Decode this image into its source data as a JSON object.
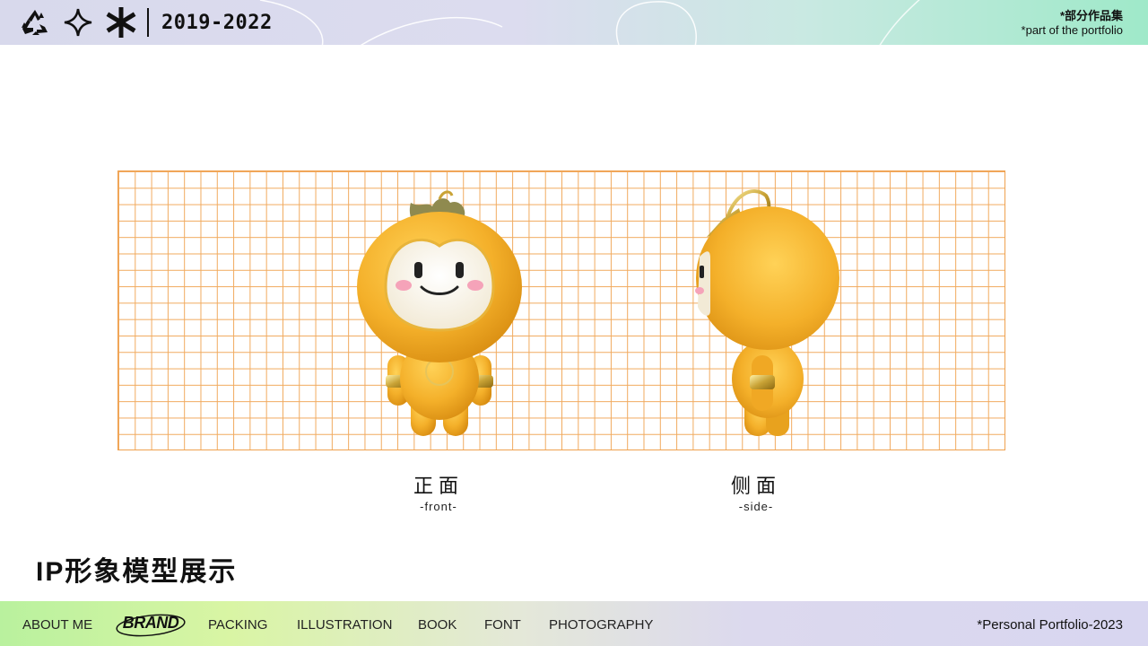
{
  "header": {
    "icons": [
      "recycle-icon",
      "four-point-star-icon",
      "asterisk-icon"
    ],
    "years": "2019-2022",
    "right_cn": "*部分作品集",
    "right_en": "*part of the portfolio"
  },
  "views": [
    {
      "cn": "正面",
      "en": "-front-"
    },
    {
      "cn": "侧面",
      "en": "-side-"
    }
  ],
  "section_title": "IP形象模型展示",
  "nav": {
    "items": [
      "ABOUT ME",
      "BRAND",
      "PACKING",
      "ILLUSTRATION",
      "BOOK",
      "FONT",
      "PHOTOGRAPHY"
    ],
    "active": "BRAND"
  },
  "footer_right": "*Personal Portfolio-2023",
  "colors": {
    "grid_line": "#efa14f",
    "mascot_body": "#f6b52c",
    "leaf": "#8f8a4f"
  }
}
